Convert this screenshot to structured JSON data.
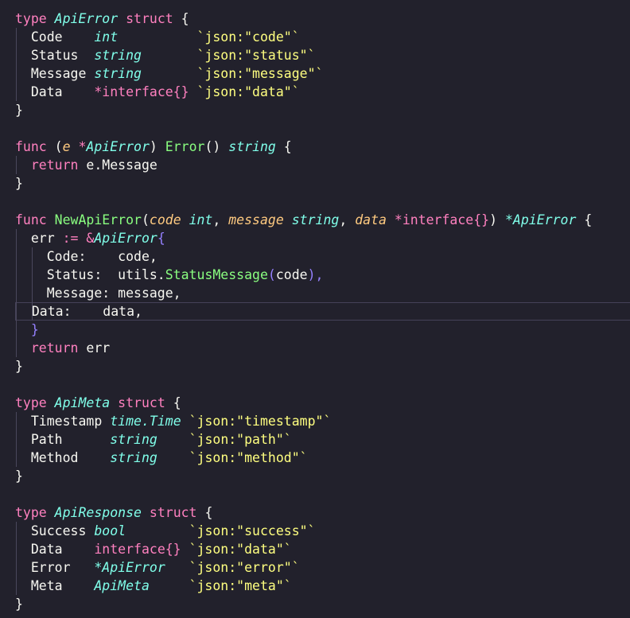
{
  "editor": {
    "background": "#22212c",
    "lines": [
      [
        {
          "t": "type ",
          "c": "kw"
        },
        {
          "t": "ApiError",
          "c": "structname"
        },
        {
          "t": " struct ",
          "c": "kw"
        },
        {
          "t": "{",
          "c": "punct"
        }
      ],
      [
        {
          "t": "  Code    ",
          "c": "name"
        },
        {
          "t": "int",
          "c": "typeit"
        },
        {
          "t": "          ",
          "c": "name"
        },
        {
          "t": "`json:\"code\"`",
          "c": "str"
        }
      ],
      [
        {
          "t": "  Status  ",
          "c": "name"
        },
        {
          "t": "string",
          "c": "typeit"
        },
        {
          "t": "       ",
          "c": "name"
        },
        {
          "t": "`json:\"status\"`",
          "c": "str"
        }
      ],
      [
        {
          "t": "  Message ",
          "c": "name"
        },
        {
          "t": "string",
          "c": "typeit"
        },
        {
          "t": "       ",
          "c": "name"
        },
        {
          "t": "`json:\"message\"`",
          "c": "str"
        }
      ],
      [
        {
          "t": "  Data    ",
          "c": "name"
        },
        {
          "t": "*interface{}",
          "c": "magenta"
        },
        {
          "t": " ",
          "c": "name"
        },
        {
          "t": "`json:\"data\"`",
          "c": "str"
        }
      ],
      [
        {
          "t": "}",
          "c": "punct"
        }
      ],
      [],
      [
        {
          "t": "func ",
          "c": "kw"
        },
        {
          "t": "(",
          "c": "punct"
        },
        {
          "t": "e ",
          "c": "param"
        },
        {
          "t": "*",
          "c": "ptr"
        },
        {
          "t": "ApiError",
          "c": "structname"
        },
        {
          "t": ") ",
          "c": "punct"
        },
        {
          "t": "Error",
          "c": "fn"
        },
        {
          "t": "() ",
          "c": "punct"
        },
        {
          "t": "string",
          "c": "typeit"
        },
        {
          "t": " {",
          "c": "punct"
        }
      ],
      [
        {
          "t": "  return ",
          "c": "kw"
        },
        {
          "t": "e.Message",
          "c": "name"
        }
      ],
      [
        {
          "t": "}",
          "c": "punct"
        }
      ],
      [],
      [
        {
          "t": "func ",
          "c": "kw"
        },
        {
          "t": "NewApiError",
          "c": "fn"
        },
        {
          "t": "(",
          "c": "punct"
        },
        {
          "t": "code ",
          "c": "param"
        },
        {
          "t": "int",
          "c": "typeit"
        },
        {
          "t": ", ",
          "c": "punct"
        },
        {
          "t": "message ",
          "c": "param"
        },
        {
          "t": "string",
          "c": "typeit"
        },
        {
          "t": ", ",
          "c": "punct"
        },
        {
          "t": "data ",
          "c": "param"
        },
        {
          "t": "*interface{}",
          "c": "magenta"
        },
        {
          "t": ") ",
          "c": "punct"
        },
        {
          "t": "*ApiError",
          "c": "structname"
        },
        {
          "t": " {",
          "c": "punct"
        }
      ],
      [
        {
          "t": "  err ",
          "c": "name"
        },
        {
          "t": ":= &",
          "c": "magenta"
        },
        {
          "t": "ApiError",
          "c": "structname"
        },
        {
          "t": "{",
          "c": "violet"
        }
      ],
      [
        {
          "t": "    Code:    ",
          "c": "name"
        },
        {
          "t": "code,",
          "c": "name"
        }
      ],
      [
        {
          "t": "    Status:  ",
          "c": "name"
        },
        {
          "t": "utils.",
          "c": "name"
        },
        {
          "t": "StatusMessage",
          "c": "fn"
        },
        {
          "t": "(",
          "c": "violet"
        },
        {
          "t": "code",
          "c": "name"
        },
        {
          "t": "),",
          "c": "violet"
        }
      ],
      [
        {
          "t": "    Message: ",
          "c": "name"
        },
        {
          "t": "message,",
          "c": "name"
        }
      ],
      [
        {
          "t": "  Data:    ",
          "c": "name"
        },
        {
          "t": "data,",
          "c": "name"
        }
      ],
      [
        {
          "t": "  }",
          "c": "violet"
        }
      ],
      [
        {
          "t": "  return ",
          "c": "kw"
        },
        {
          "t": "err",
          "c": "name"
        }
      ],
      [
        {
          "t": "}",
          "c": "punct"
        }
      ],
      [],
      [
        {
          "t": "type ",
          "c": "kw"
        },
        {
          "t": "ApiMeta",
          "c": "structname"
        },
        {
          "t": " struct ",
          "c": "kw"
        },
        {
          "t": "{",
          "c": "punct"
        }
      ],
      [
        {
          "t": "  Timestamp ",
          "c": "name"
        },
        {
          "t": "time.Time",
          "c": "typeit"
        },
        {
          "t": " ",
          "c": "name"
        },
        {
          "t": "`json:\"timestamp\"`",
          "c": "str"
        }
      ],
      [
        {
          "t": "  Path      ",
          "c": "name"
        },
        {
          "t": "string",
          "c": "typeit"
        },
        {
          "t": "    ",
          "c": "name"
        },
        {
          "t": "`json:\"path\"`",
          "c": "str"
        }
      ],
      [
        {
          "t": "  Method    ",
          "c": "name"
        },
        {
          "t": "string",
          "c": "typeit"
        },
        {
          "t": "    ",
          "c": "name"
        },
        {
          "t": "`json:\"method\"`",
          "c": "str"
        }
      ],
      [
        {
          "t": "}",
          "c": "punct"
        }
      ],
      [],
      [
        {
          "t": "type ",
          "c": "kw"
        },
        {
          "t": "ApiResponse",
          "c": "structname"
        },
        {
          "t": " struct ",
          "c": "kw"
        },
        {
          "t": "{",
          "c": "punct"
        }
      ],
      [
        {
          "t": "  Success ",
          "c": "name"
        },
        {
          "t": "bool",
          "c": "typeit"
        },
        {
          "t": "        ",
          "c": "name"
        },
        {
          "t": "`json:\"success\"`",
          "c": "str"
        }
      ],
      [
        {
          "t": "  Data    ",
          "c": "name"
        },
        {
          "t": "interface{}",
          "c": "magenta"
        },
        {
          "t": " ",
          "c": "name"
        },
        {
          "t": "`json:\"data\"`",
          "c": "str"
        }
      ],
      [
        {
          "t": "  Error   ",
          "c": "name"
        },
        {
          "t": "*ApiError",
          "c": "structname"
        },
        {
          "t": "   ",
          "c": "name"
        },
        {
          "t": "`json:\"error\"`",
          "c": "str"
        }
      ],
      [
        {
          "t": "  Meta    ",
          "c": "name"
        },
        {
          "t": "ApiMeta",
          "c": "structname"
        },
        {
          "t": "     ",
          "c": "name"
        },
        {
          "t": "`json:\"meta\"`",
          "c": "str"
        }
      ],
      [
        {
          "t": "}",
          "c": "punct"
        }
      ]
    ],
    "current_line": 16
  }
}
